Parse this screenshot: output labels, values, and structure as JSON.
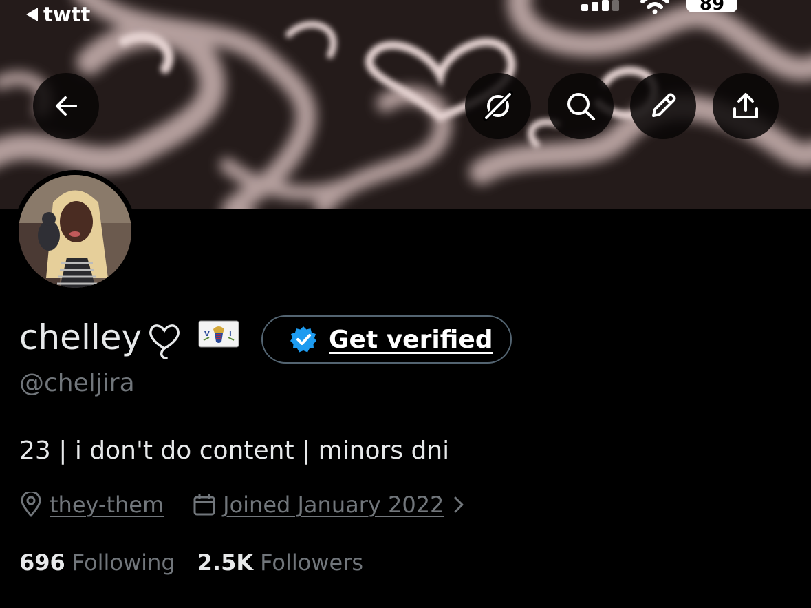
{
  "status_bar": {
    "back_app": "twtt",
    "battery": "89"
  },
  "banner": {
    "colors": {
      "background": "#2a201f",
      "swirl": "#d8c3c1"
    }
  },
  "toolbar": {
    "back_icon": "arrow-left-icon",
    "grok_icon": "grok-icon",
    "search_icon": "search-icon",
    "edit_icon": "pencil-icon",
    "share_icon": "share-upload-icon"
  },
  "profile": {
    "display_name": "chelley",
    "name_emoji": [
      "heart-icon",
      "flag-us-virgin-islands-icon"
    ],
    "verify_button": "Get verified",
    "handle": "@cheljira",
    "bio": "23 | i don't do content | minors dni",
    "location": "they-them",
    "joined": "Joined January 2022",
    "following_count": "696",
    "following_label": "Following",
    "followers_count": "2.5K",
    "followers_label": "Followers"
  },
  "colors": {
    "accent_blue": "#1d9bf0",
    "muted_text": "#71767b",
    "text": "#e7e9ea",
    "border": "#536471"
  }
}
